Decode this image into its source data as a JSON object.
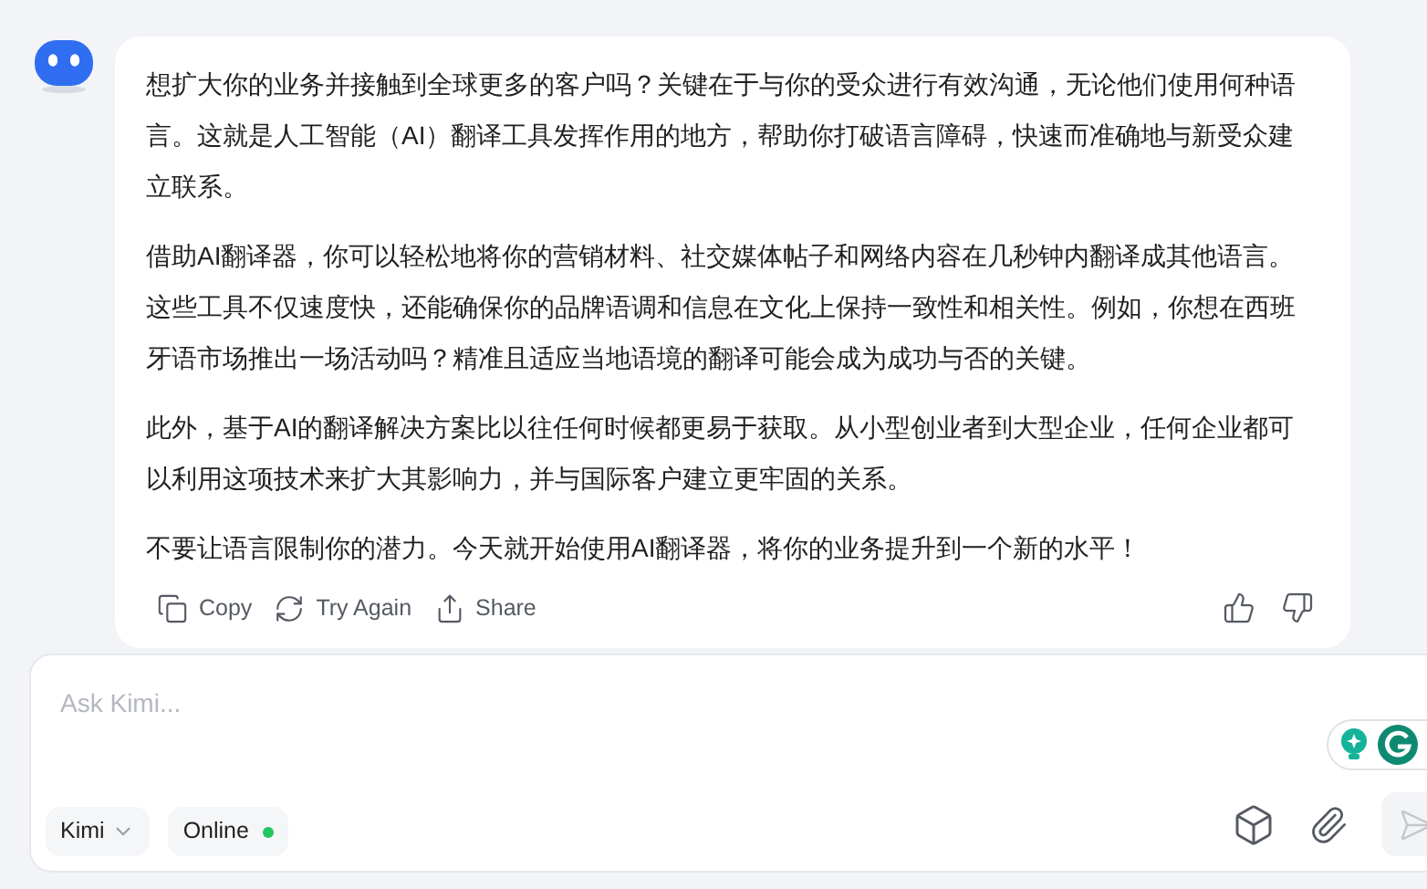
{
  "message": {
    "paragraphs": [
      "想扩大你的业务并接触到全球更多的客户吗？关键在于与你的受众进行有效沟通，无论他们使用何种语言。这就是人工智能（AI）翻译工具发挥作用的地方，帮助你打破语言障碍，快速而准确地与新受众建立联系。",
      "借助AI翻译器，你可以轻松地将你的营销材料、社交媒体帖子和网络内容在几秒钟内翻译成其他语言。这些工具不仅速度快，还能确保你的品牌语调和信息在文化上保持一致性和相关性。例如，你想在西班牙语市场推出一场活动吗？精准且适应当地语境的翻译可能会成为成功与否的关键。",
      "此外，基于AI的翻译解决方案比以往任何时候都更易于获取。从小型创业者到大型企业，任何企业都可以利用这项技术来扩大其影响力，并与国际客户建立更牢固的关系。",
      "不要让语言限制你的潜力。今天就开始使用AI翻译器，将你的业务提升到一个新的水平！"
    ],
    "actions": [
      {
        "kind": "copy",
        "label": "Copy"
      },
      {
        "kind": "retry",
        "label": "Try Again"
      },
      {
        "kind": "share",
        "label": "Share"
      }
    ]
  },
  "composer": {
    "placeholder": "Ask Kimi...",
    "model": "Kimi",
    "online": {
      "label": "Online",
      "active": true
    },
    "send_disabled": true
  }
}
